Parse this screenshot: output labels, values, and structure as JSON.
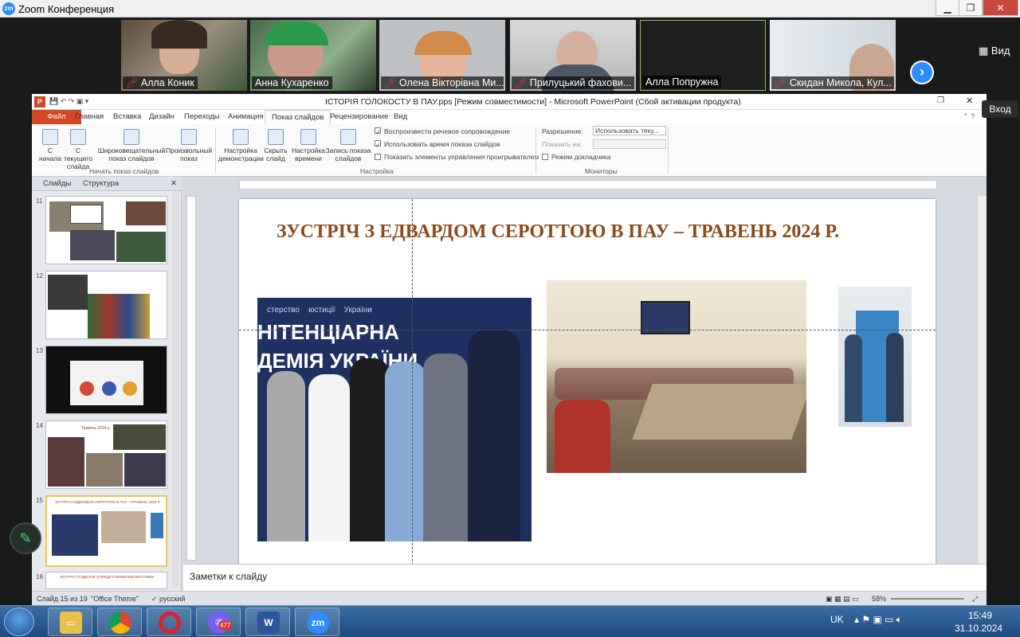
{
  "zoom": {
    "window_title": "Zoom Конференция",
    "logo": "zm",
    "view_label": "Вид",
    "enter_tooltip": "Вход",
    "participants": [
      {
        "name": "Алла Коник",
        "muted": true
      },
      {
        "name": "Анна Кухаренко",
        "muted": false
      },
      {
        "name": "Олена Вікторівна Ми...",
        "muted": true
      },
      {
        "name": "Прилуцький  фахови...",
        "muted": true
      },
      {
        "name": "Алла Попружна",
        "muted": false
      },
      {
        "name": "Скидан Микола, Кул...",
        "muted": true
      }
    ],
    "next_icon": "chevron-right-icon"
  },
  "ppt": {
    "title": "ІСТОРІЯ ГОЛОКОСТУ В ПАУ.pps [Режим совместимости] - Microsoft PowerPoint (Сбой активации продукта)",
    "tabs": [
      "Файл",
      "Главная",
      "Вставка",
      "Дизайн",
      "Переходы",
      "Анимация",
      "Показ слайдов",
      "Рецензирование",
      "Вид"
    ],
    "ribbon": {
      "buttons": [
        "С начала",
        "С текущего слайда",
        "Широковещательный показ слайдов",
        "Произвольный показ",
        "Настройка демонстрации",
        "Скрыть слайд",
        "Настройка времени",
        "Запись показа слайдов"
      ],
      "groups": [
        "Начать показ слайдов",
        "Настройка",
        "Мониторы"
      ],
      "checks": [
        "Воспроизвести речевое сопровождение",
        "Использовать время показа слайдов",
        "Показать элементы управления проигрывателем",
        "Режим докладчика"
      ],
      "resolution_label": "Разрешение:",
      "resolution_value": "Использовать теку...",
      "show_on_label": "Показать на:"
    },
    "pane_tabs": [
      "Слайды",
      "Структура"
    ],
    "thumbnails": [
      {
        "num": "11"
      },
      {
        "num": "12"
      },
      {
        "num": "13"
      },
      {
        "num": "14",
        "title": "Травень 2024 р."
      },
      {
        "num": "15",
        "selected": true,
        "title": "ЗУСТРІЧ З ЕДВАРДОМ СЕРОТТОЮ В ПАУ – ТРАВЕНЬ 2024 Р."
      },
      {
        "num": "16",
        "title": "ЗУСТРІЧ СТУДЕНТІВ З ПРЕДСТАВНИКАМИ ВИСТАВКИ"
      }
    ],
    "slide": {
      "title": "ЗУСТРІЧ З ЕДВАРДОМ СЕРОТТОЮ В ПАУ – ТРАВЕНЬ 2024 Р.",
      "photo1_banner_top": [
        "стерство",
        "юстиції",
        "України"
      ],
      "photo1_banner_big": [
        "НІТЕНЦІАРНА",
        "ДЕМІЯ УКРАЇНИ"
      ]
    },
    "notes_placeholder": "Заметки к слайду",
    "status": {
      "slide_info": "Слайд 15 из 19",
      "theme": "\"Office Theme\"",
      "language": "русский",
      "zoom": "58%"
    }
  },
  "taskbar": {
    "apps": [
      {
        "name": "file-explorer"
      },
      {
        "name": "chrome"
      },
      {
        "name": "opera"
      },
      {
        "name": "viber",
        "badge": "477"
      },
      {
        "name": "word"
      },
      {
        "name": "zoom",
        "label": "zm"
      }
    ],
    "lang": "UK",
    "time": "15:49",
    "date": "31.10.2024"
  }
}
